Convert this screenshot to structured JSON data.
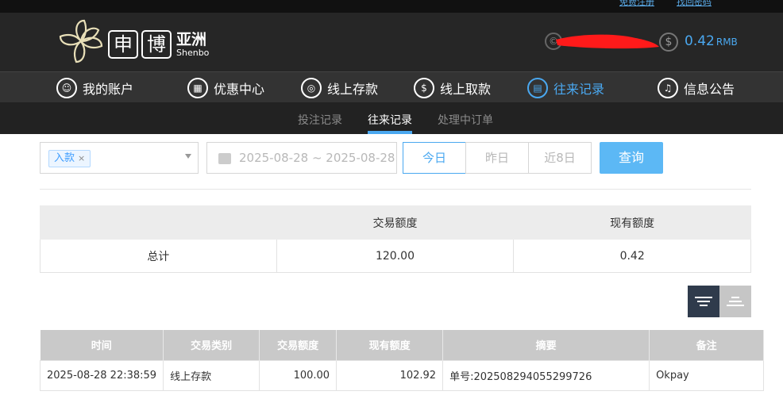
{
  "header": {
    "top_links": [
      "免费注册",
      "找回密码"
    ],
    "brand_chars": [
      "申",
      "博"
    ],
    "brand_region": "亚洲",
    "brand_en": "Shenbo",
    "balance_symbol": "$",
    "balance_amount": "0.42",
    "balance_currency": "RMB"
  },
  "nav": {
    "items": [
      {
        "label": "我的账户",
        "icon": "user-icon"
      },
      {
        "label": "优惠中心",
        "icon": "gift-icon"
      },
      {
        "label": "线上存款",
        "icon": "deposit-icon"
      },
      {
        "label": "线上取款",
        "icon": "withdraw-icon"
      },
      {
        "label": "往来记录",
        "icon": "records-icon"
      },
      {
        "label": "信息公告",
        "icon": "bell-icon"
      }
    ],
    "active": "往来记录"
  },
  "subnav": {
    "items": [
      "投注记录",
      "往来记录",
      "处理中订单"
    ],
    "active": "往来记录"
  },
  "filter": {
    "type_tag": "入款",
    "tag_remove": "×",
    "date_range": "2025-08-28 ~ 2025-08-28",
    "quick": [
      "今日",
      "昨日",
      "近8日"
    ],
    "quick_active": "今日",
    "search_label": "查询"
  },
  "summary": {
    "headers": [
      "",
      "交易额度",
      "现有额度"
    ],
    "row": {
      "label": "总计",
      "trade": "120.00",
      "current": "0.42"
    }
  },
  "detail": {
    "headers": [
      "时间",
      "交易类别",
      "交易额度",
      "现有额度",
      "摘要",
      "备注"
    ],
    "rows": [
      [
        "2025-08-28 22:38:59",
        "线上存款",
        "100.00",
        "102.92",
        "单号:202508294055299726",
        "Okpay"
      ]
    ]
  },
  "colors": {
    "accent": "#4aa8f0",
    "header_bg": "#262626",
    "nav_bg": "#333333"
  }
}
